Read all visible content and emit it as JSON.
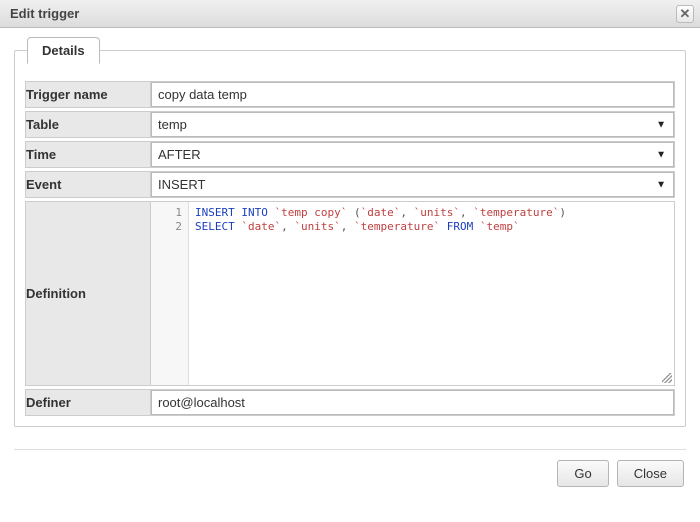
{
  "dialog": {
    "title": "Edit trigger"
  },
  "tabs": {
    "details": "Details"
  },
  "form": {
    "trigger_name": {
      "label": "Trigger name",
      "value": "copy data temp"
    },
    "table": {
      "label": "Table",
      "value": "temp"
    },
    "time": {
      "label": "Time",
      "value": "AFTER"
    },
    "event": {
      "label": "Event",
      "value": "INSERT"
    },
    "definition": {
      "label": "Definition"
    },
    "definer": {
      "label": "Definer",
      "value": "root@localhost"
    }
  },
  "editor": {
    "line_numbers": [
      "1",
      "2"
    ],
    "tokens": [
      [
        {
          "t": "INSERT",
          "c": "kw"
        },
        {
          "t": " ",
          "c": ""
        },
        {
          "t": "INTO",
          "c": "kw"
        },
        {
          "t": " ",
          "c": ""
        },
        {
          "t": "`temp copy`",
          "c": "str"
        },
        {
          "t": " ",
          "c": ""
        },
        {
          "t": "(",
          "c": "pn"
        },
        {
          "t": "`date`",
          "c": "str"
        },
        {
          "t": ",",
          "c": "pn"
        },
        {
          "t": " ",
          "c": ""
        },
        {
          "t": "`units`",
          "c": "str"
        },
        {
          "t": ",",
          "c": "pn"
        },
        {
          "t": " ",
          "c": ""
        },
        {
          "t": "`temperature`",
          "c": "str"
        },
        {
          "t": ")",
          "c": "pn"
        }
      ],
      [
        {
          "t": "SELECT",
          "c": "kw"
        },
        {
          "t": " ",
          "c": ""
        },
        {
          "t": "`date`",
          "c": "str"
        },
        {
          "t": ",",
          "c": "pn"
        },
        {
          "t": " ",
          "c": ""
        },
        {
          "t": "`units`",
          "c": "str"
        },
        {
          "t": ",",
          "c": "pn"
        },
        {
          "t": " ",
          "c": ""
        },
        {
          "t": "`temperature`",
          "c": "str"
        },
        {
          "t": " ",
          "c": ""
        },
        {
          "t": "FROM",
          "c": "kw"
        },
        {
          "t": " ",
          "c": ""
        },
        {
          "t": "`temp`",
          "c": "str"
        }
      ]
    ]
  },
  "footer": {
    "go": "Go",
    "close": "Close"
  }
}
